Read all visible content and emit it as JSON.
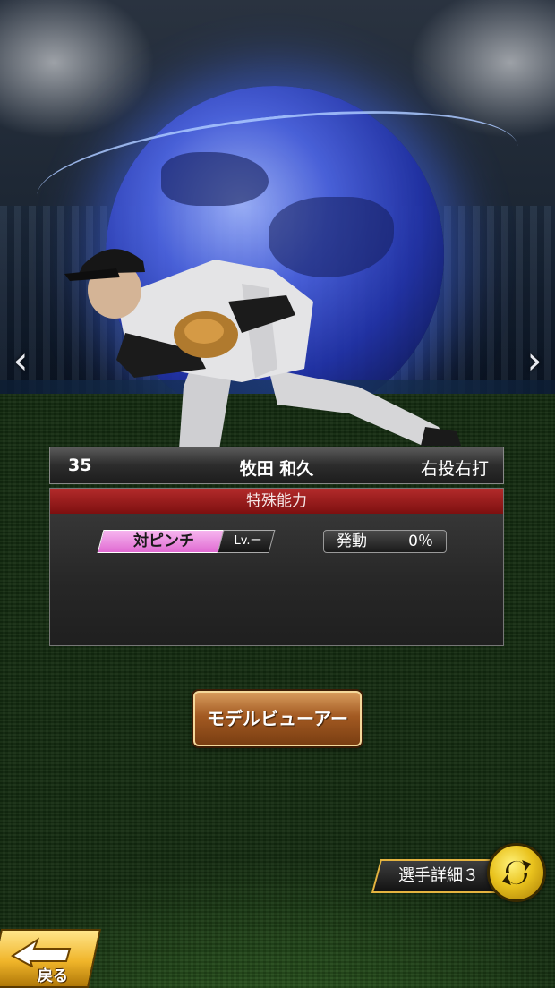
{
  "player": {
    "number": "35",
    "name": "牧田 和久",
    "throw_bat": "右投右打"
  },
  "ability_panel": {
    "header": "特殊能力",
    "skill_name": "対ピンチ",
    "skill_level": "Lv.ー",
    "trigger_label": "発動",
    "trigger_value": "0％"
  },
  "buttons": {
    "model_viewer": "モデルビューアー",
    "player_detail": "選手詳細３",
    "back": "戻る"
  },
  "nav": {
    "prev": "‹",
    "next": "›"
  },
  "colors": {
    "accent_gold": "#e5b440",
    "header_red": "#9e1c1c",
    "skill_pink": "#e06ad2",
    "button_brown": "#a35a22"
  },
  "icons": [
    "chevron-left-icon",
    "chevron-right-icon",
    "swap-arrows-icon",
    "back-arrow-icon"
  ]
}
